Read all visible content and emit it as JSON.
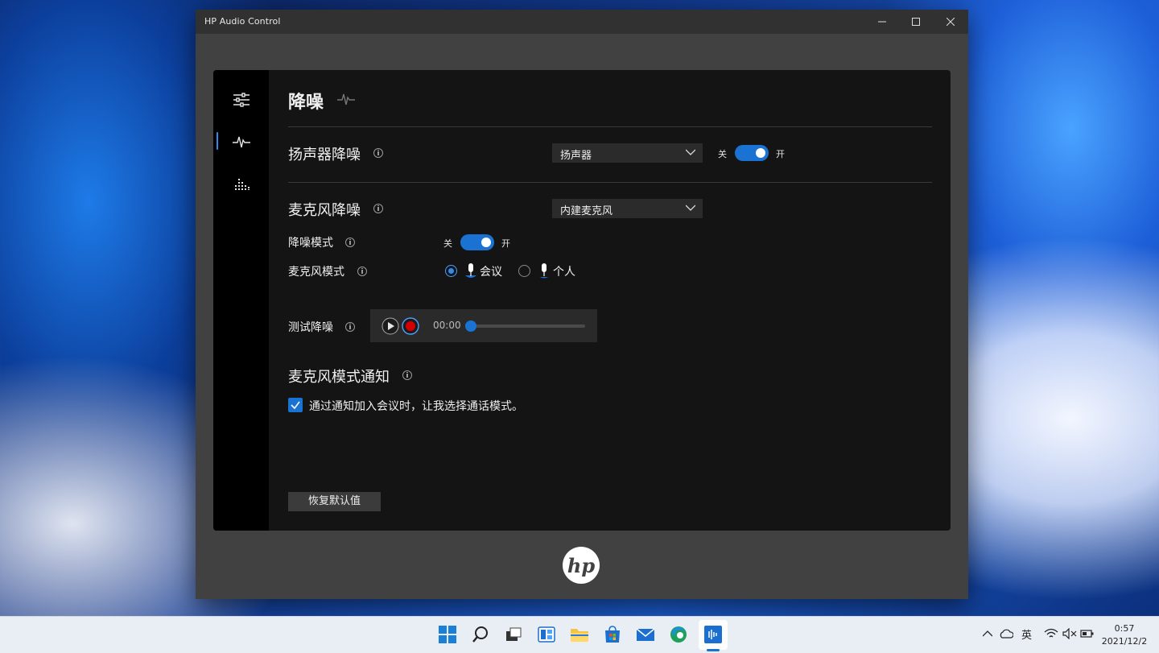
{
  "window": {
    "title": "HP Audio Control"
  },
  "page": {
    "title": "降噪"
  },
  "speaker": {
    "heading": "扬声器降噪",
    "device": "扬声器",
    "toggle_off": "关",
    "toggle_on": "开",
    "enabled": true
  },
  "mic": {
    "heading": "麦克风降噪",
    "device": "内建麦克风",
    "nr_mode_label": "降噪模式",
    "nr_toggle_off": "关",
    "nr_toggle_on": "开",
    "nr_enabled": true,
    "mode_label": "麦克风模式",
    "mode_options": [
      {
        "label": "会议",
        "selected": true
      },
      {
        "label": "个人",
        "selected": false
      }
    ]
  },
  "test": {
    "label": "测试降噪",
    "time": "00:00",
    "progress": 0
  },
  "notification": {
    "heading": "麦克风模式通知",
    "checkbox_label": "通过通知加入会议时，让我选择通话模式。",
    "checked": true
  },
  "reset_button": "恢复默认值",
  "logo": "hp",
  "taskbar": {
    "ime": "英",
    "time": "0:57",
    "date": "2021/12/2"
  },
  "colors": {
    "accent": "#1a73d2",
    "record": "#d40000"
  }
}
